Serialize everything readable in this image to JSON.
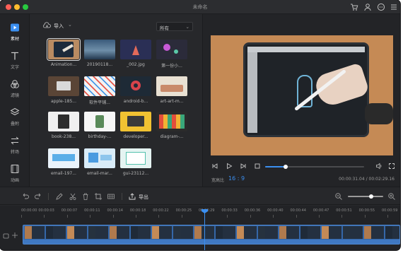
{
  "window": {
    "title": "未命名"
  },
  "sidebar": {
    "items": [
      {
        "label": "素材",
        "icon": "media-icon",
        "active": true
      },
      {
        "label": "文字",
        "icon": "text-icon",
        "active": false
      },
      {
        "label": "滤镜",
        "icon": "filter-icon",
        "active": false
      },
      {
        "label": "叠附",
        "icon": "overlay-icon",
        "active": false
      },
      {
        "label": "转场",
        "icon": "transition-icon",
        "active": false
      },
      {
        "label": "动画",
        "icon": "animation-icon",
        "active": false
      }
    ]
  },
  "library": {
    "import_label": "导入",
    "filter_value": "所有",
    "items": [
      {
        "label": "Animation...",
        "kind": "video",
        "selected": true
      },
      {
        "label": "20190118...",
        "kind": "image"
      },
      {
        "label": "_002.jpg",
        "kind": "image"
      },
      {
        "label": "第一份小...",
        "kind": "image"
      },
      {
        "label": "apple-185...",
        "kind": "image"
      },
      {
        "label": "软件平铺...",
        "kind": "image"
      },
      {
        "label": "android-b...",
        "kind": "image"
      },
      {
        "label": "art-art-m...",
        "kind": "image"
      },
      {
        "label": "book-238...",
        "kind": "image"
      },
      {
        "label": "birthday-...",
        "kind": "image"
      },
      {
        "label": "developer...",
        "kind": "image"
      },
      {
        "label": "diagram-...",
        "kind": "image"
      },
      {
        "label": "email-197...",
        "kind": "image"
      },
      {
        "label": "email-mar...",
        "kind": "image"
      },
      {
        "label": "gui-23112...",
        "kind": "image"
      }
    ]
  },
  "preview": {
    "aspect_label": "宽高比",
    "aspect_value": "16 : 9",
    "time_display": "00:00:31.04 / 00:02:29.16",
    "progress": 0.21
  },
  "toolbar": {
    "export_label": "导出",
    "zoom_level": 0.66
  },
  "timeline": {
    "ticks": [
      "00:00:00",
      "00:00:03",
      "00:00:07",
      "00:00:11",
      "00:00:14",
      "00:00:18",
      "00:00:22",
      "00:00:25",
      "00:00:29",
      "00:00:33",
      "00:00:36",
      "00:00:40",
      "00:00:44",
      "00:00:47",
      "00:00:51",
      "00:00:55",
      "00:00:59"
    ]
  },
  "colors": {
    "accent": "#3b8ff0",
    "clip": "#3567a8"
  }
}
